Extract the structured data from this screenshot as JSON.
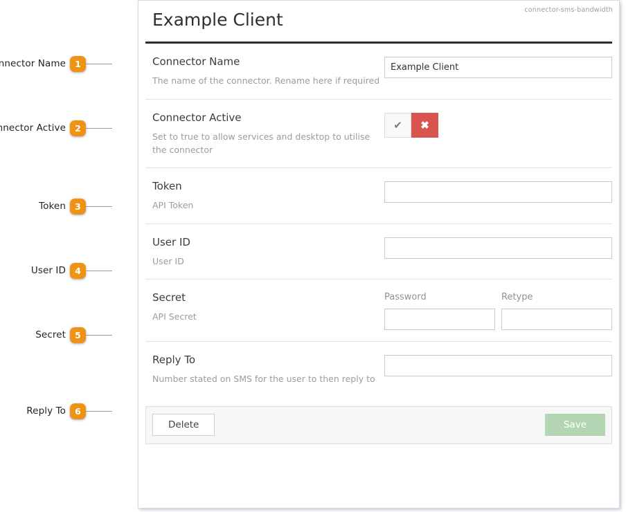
{
  "panel": {
    "title": "Example Client",
    "tag": "connector-sms-bandwidth"
  },
  "rows": [
    {
      "key": "connector_name",
      "title": "Connector Name",
      "description": "The name of the connector. Rename here if required",
      "value": "Example Client"
    },
    {
      "key": "connector_active",
      "title": "Connector Active",
      "description": "Set to true to allow services and desktop to utilise the connector",
      "toggle": {
        "yes_icon": "check-icon",
        "yes_glyph": "✔",
        "no_icon": "cross-icon",
        "no_glyph": "✖",
        "selected": "no"
      }
    },
    {
      "key": "token",
      "title": "Token",
      "description": "API Token",
      "value": ""
    },
    {
      "key": "user_id",
      "title": "User ID",
      "description": "User ID",
      "value": ""
    },
    {
      "key": "secret",
      "title": "Secret",
      "description": "API Secret",
      "password_label": "Password",
      "retype_label": "Retype",
      "password_value": "",
      "retype_value": ""
    },
    {
      "key": "reply_to",
      "title": "Reply To",
      "description": "Number stated on SMS for the user to then reply to",
      "value": ""
    }
  ],
  "footer": {
    "delete_label": "Delete",
    "save_label": "Save"
  },
  "callouts": [
    {
      "number": "1",
      "label": "Connector Name"
    },
    {
      "number": "2",
      "label": "Connector Active"
    },
    {
      "number": "3",
      "label": "Token"
    },
    {
      "number": "4",
      "label": "User ID"
    },
    {
      "number": "5",
      "label": "Secret"
    },
    {
      "number": "6",
      "label": "Reply To"
    }
  ],
  "colors": {
    "callout_badge": "#ee9313",
    "toggle_no": "#d9534f",
    "save_disabled": "#b3d5b3",
    "title_rule": "#2b2b33"
  }
}
